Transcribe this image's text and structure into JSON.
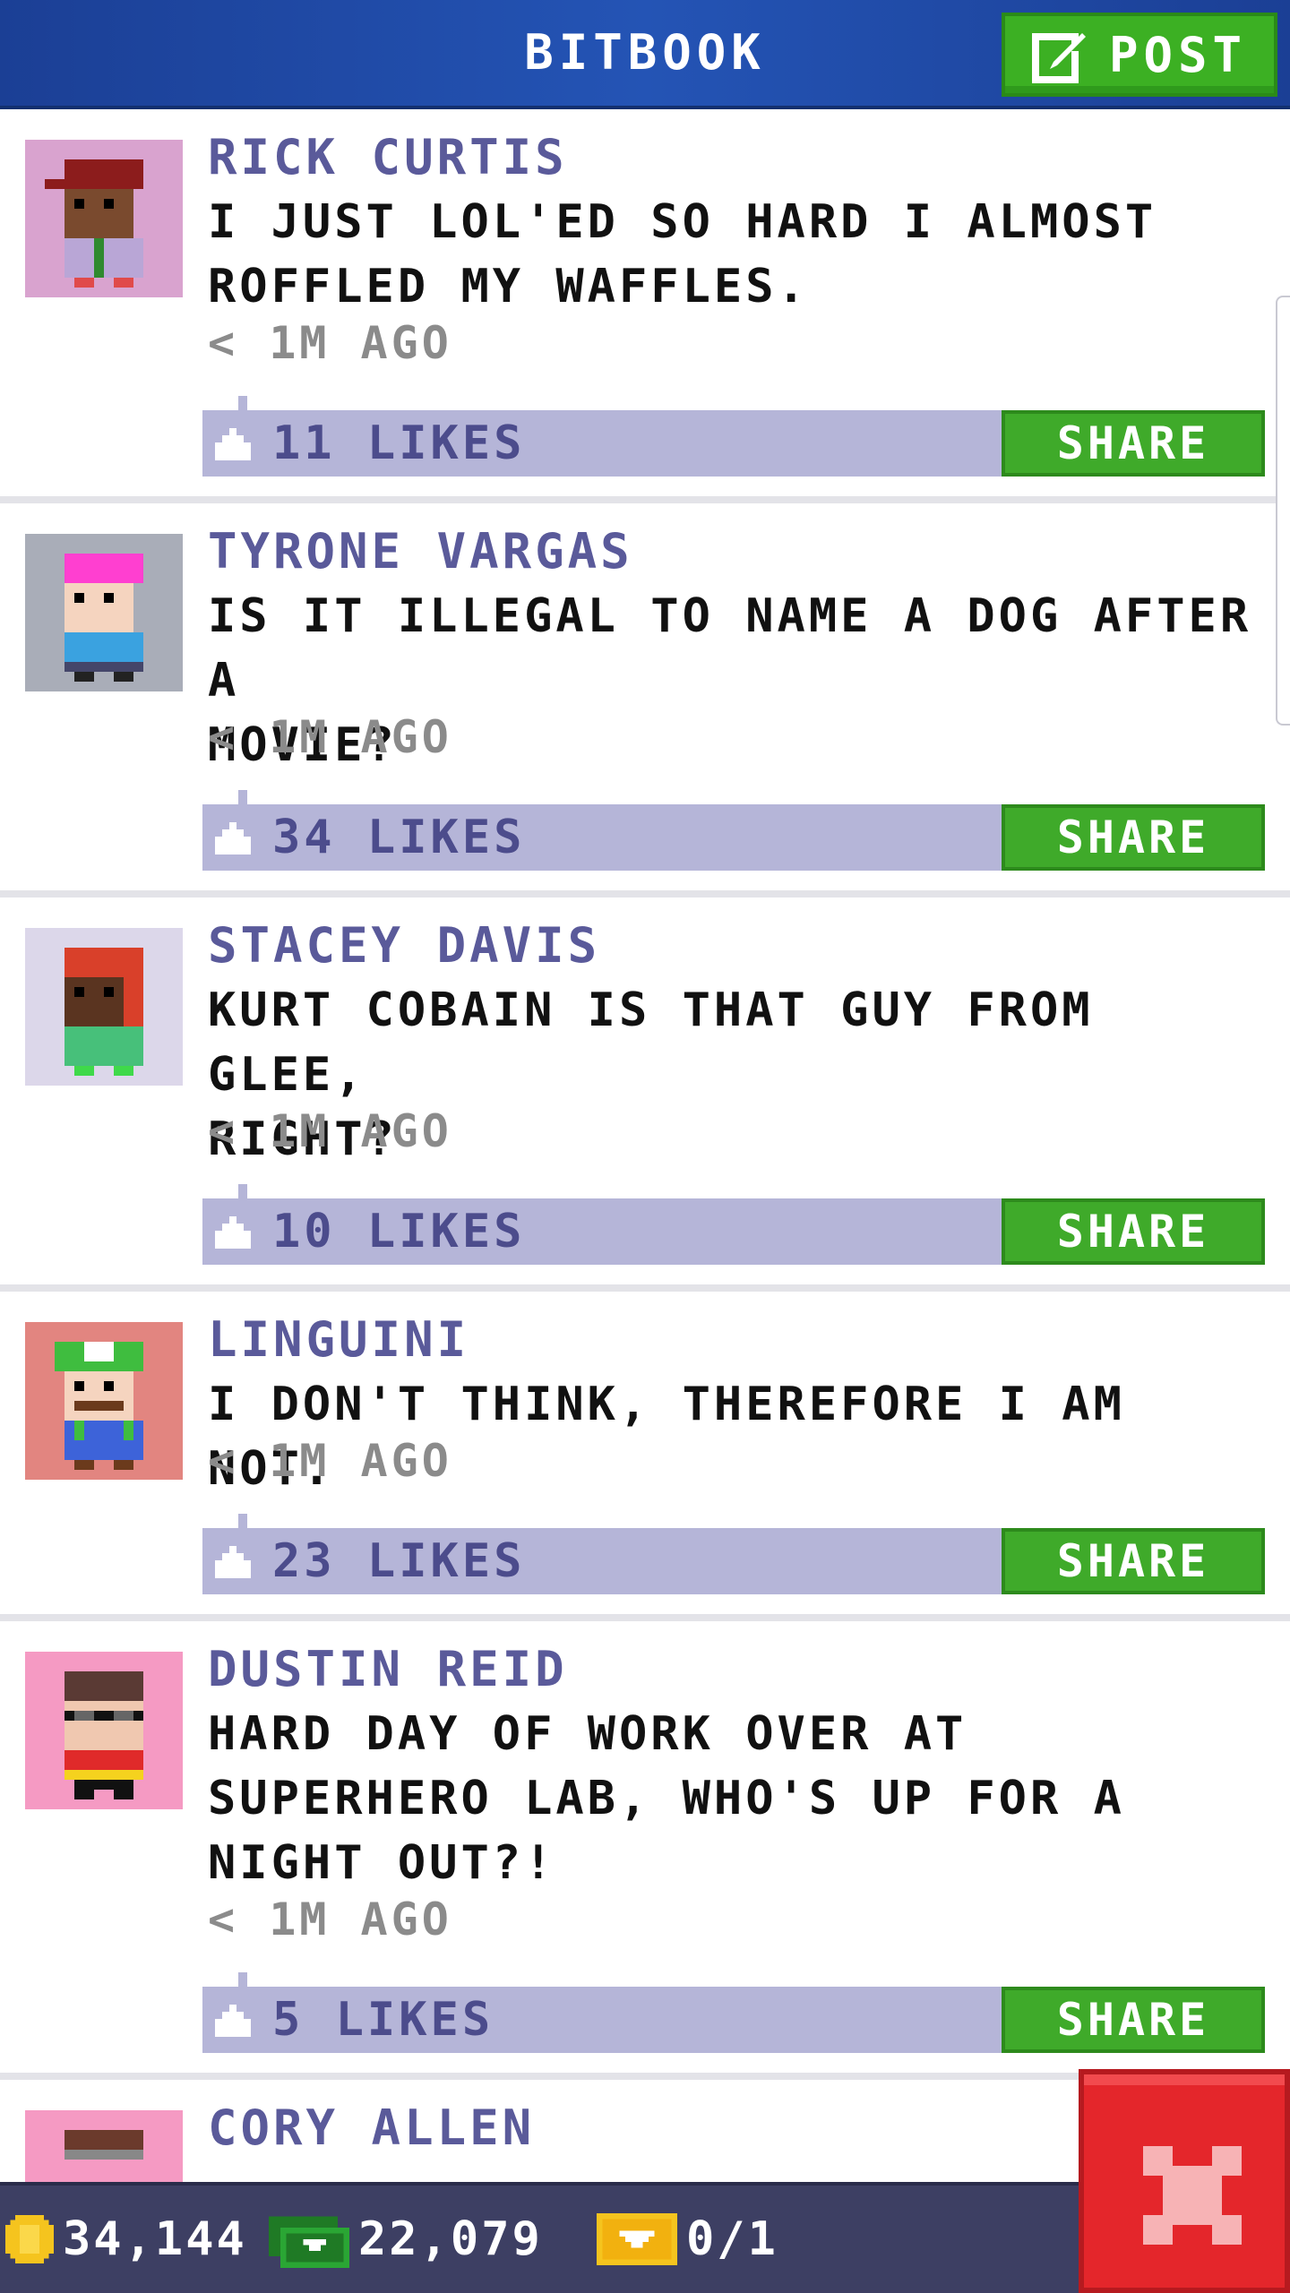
{
  "header": {
    "title": "BITBOOK",
    "post_label": "POST"
  },
  "posts": [
    {
      "name": "RICK CURTIS",
      "text": "I JUST LOL'ED SO HARD I ALMOST\nROFFLED MY WAFFLES.",
      "time": "< 1M AGO",
      "likes": "11 LIKES",
      "share_label": "SHARE"
    },
    {
      "name": "TYRONE VARGAS",
      "text": "IS IT ILLEGAL TO NAME A DOG AFTER A\nMOVIE?",
      "time": "< 1M AGO",
      "likes": "34 LIKES",
      "share_label": "SHARE"
    },
    {
      "name": "STACEY DAVIS",
      "text": "KURT COBAIN IS THAT GUY FROM GLEE,\nRIGHT?",
      "time": "< 1M AGO",
      "likes": "10 LIKES",
      "share_label": "SHARE"
    },
    {
      "name": "LINGUINI",
      "text": "I DON'T THINK, THEREFORE I AM NOT.",
      "time": "< 1M AGO",
      "likes": "23 LIKES",
      "share_label": "SHARE"
    },
    {
      "name": "DUSTIN REID",
      "text": "HARD DAY OF WORK OVER AT\nSUPERHERO LAB, WHO'S UP FOR A\nNIGHT OUT?!",
      "time": "< 1M AGO",
      "likes": "5 LIKES",
      "share_label": "SHARE"
    },
    {
      "name": "CORY ALLEN"
    }
  ],
  "bottom_bar": {
    "coins": "34,144",
    "bux": "22,079",
    "tickets": "0/1"
  },
  "colors": {
    "header": "#2454b5",
    "accent_green": "#3faa2a",
    "likes_bar": "#b5b5d8",
    "name": "#5a5a9a",
    "close": "#e4262b"
  },
  "icons": {
    "post": "edit-icon",
    "like": "thumbs-up-icon",
    "coin": "coin-icon",
    "bux": "bux-icon",
    "ticket": "ticket-icon",
    "close": "close-icon"
  }
}
